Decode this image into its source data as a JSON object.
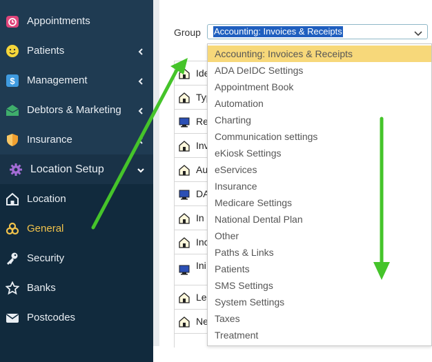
{
  "sidebar": {
    "items": [
      {
        "label": "Appointments",
        "icon": "calendar-icon"
      },
      {
        "label": "Patients",
        "icon": "smiley-icon"
      },
      {
        "label": "Management",
        "icon": "dollar-icon"
      },
      {
        "label": "Debtors & Marketing",
        "icon": "envelope-icon"
      },
      {
        "label": "Insurance",
        "icon": "shield-icon"
      },
      {
        "label": "Location Setup",
        "icon": "gear-icon"
      },
      {
        "label": "Location",
        "icon": "home-icon"
      },
      {
        "label": "General",
        "icon": "cogs-icon"
      },
      {
        "label": "Security",
        "icon": "key-icon"
      },
      {
        "label": "Banks",
        "icon": "star-icon"
      },
      {
        "label": "Postcodes",
        "icon": "mail-icon"
      }
    ]
  },
  "main": {
    "group_label": "Group",
    "group_selected": "Accounting: Invoices & Receipts",
    "rows": [
      {
        "text": "Ide",
        "icon": "home-icon"
      },
      {
        "text": "Typ",
        "icon": "home-icon"
      },
      {
        "text": "Re",
        "icon": "computer-icon"
      },
      {
        "text": "Inv",
        "icon": "home-icon"
      },
      {
        "text": "Au",
        "icon": "home-icon"
      },
      {
        "text": "DA",
        "icon": "computer-icon"
      },
      {
        "text": "In",
        "icon": "home-icon"
      },
      {
        "text": "Inc",
        "icon": "home-icon"
      },
      {
        "text": "Ini",
        "icon": "computer-icon"
      },
      {
        "text": "Le",
        "icon": "home-icon"
      },
      {
        "text": "Ne",
        "icon": "home-icon"
      }
    ]
  },
  "dropdown": {
    "options": [
      "Accounting: Invoices & Receipts",
      "ADA DeIDC Settings",
      "Appointment Book",
      "Automation",
      "Charting",
      "Communication settings",
      "eKiosk Settings",
      "eServices",
      "Insurance",
      "Medicare Settings",
      "National Dental Plan",
      "Other",
      "Paths & Links",
      "Patients",
      "SMS Settings",
      "System Settings",
      "Taxes",
      "Treatment"
    ]
  },
  "colors": {
    "sidebar_bg": "#1f3b52",
    "active_text": "#f2c34b",
    "selected_option": "#f7d87a",
    "annotation_arrow": "#45c42a"
  }
}
